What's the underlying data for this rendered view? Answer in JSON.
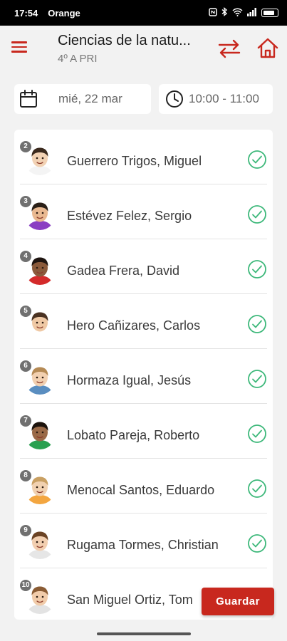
{
  "status_bar": {
    "time": "17:54",
    "carrier": "Orange"
  },
  "header": {
    "title": "Ciencias de la natu...",
    "subtitle": "4º A PRI"
  },
  "icons": {
    "menu": "menu-icon",
    "swap": "swap-arrows-icon",
    "home": "home-icon",
    "calendar": "calendar-icon",
    "clock": "clock-icon",
    "check": "check-circle-icon"
  },
  "session": {
    "date": "mié, 22 mar",
    "time": "10:00 - 11:00"
  },
  "students": [
    {
      "number": "2",
      "name": "Guerrero Trigos, Miguel",
      "present": true,
      "shirt": "#f4f4f4",
      "skin": "#f2d2b4",
      "hair": "#3b2a1e"
    },
    {
      "number": "3",
      "name": "Estévez Felez, Sergio",
      "present": true,
      "shirt": "#8a3ec2",
      "skin": "#e9b991",
      "hair": "#2a1f17"
    },
    {
      "number": "4",
      "name": "Gadea Frera, David",
      "present": true,
      "shirt": "#d42a2a",
      "skin": "#8a5a3b",
      "hair": "#1e1410"
    },
    {
      "number": "5",
      "name": "Hero Cañizares, Carlos",
      "present": true,
      "shirt": "#ffffff",
      "skin": "#efc9a5",
      "hair": "#4a3222"
    },
    {
      "number": "6",
      "name": "Hormaza Igual, Jesús",
      "present": true,
      "shirt": "#5a8ec0",
      "skin": "#f2d0b0",
      "hair": "#b58a55"
    },
    {
      "number": "7",
      "name": "Lobato Pareja, Roberto",
      "present": true,
      "shirt": "#2aa050",
      "skin": "#9a6a48",
      "hair": "#1b120c"
    },
    {
      "number": "8",
      "name": "Menocal Santos, Eduardo",
      "present": true,
      "shirt": "#f3a640",
      "skin": "#f1d1b0",
      "hair": "#c9a063"
    },
    {
      "number": "9",
      "name": "Rugama Tormes, Christian",
      "present": true,
      "shirt": "#e6e6e6",
      "skin": "#f2cfb0",
      "hair": "#6b4324"
    },
    {
      "number": "10",
      "name": "San Miguel Ortiz, Tom",
      "present": true,
      "shirt": "#e3e3e3",
      "skin": "#f1ccaa",
      "hair": "#8a5c34"
    }
  ],
  "actions": {
    "save_label": "Guardar"
  },
  "colors": {
    "accent": "#c8281e",
    "check": "#3db87a"
  }
}
